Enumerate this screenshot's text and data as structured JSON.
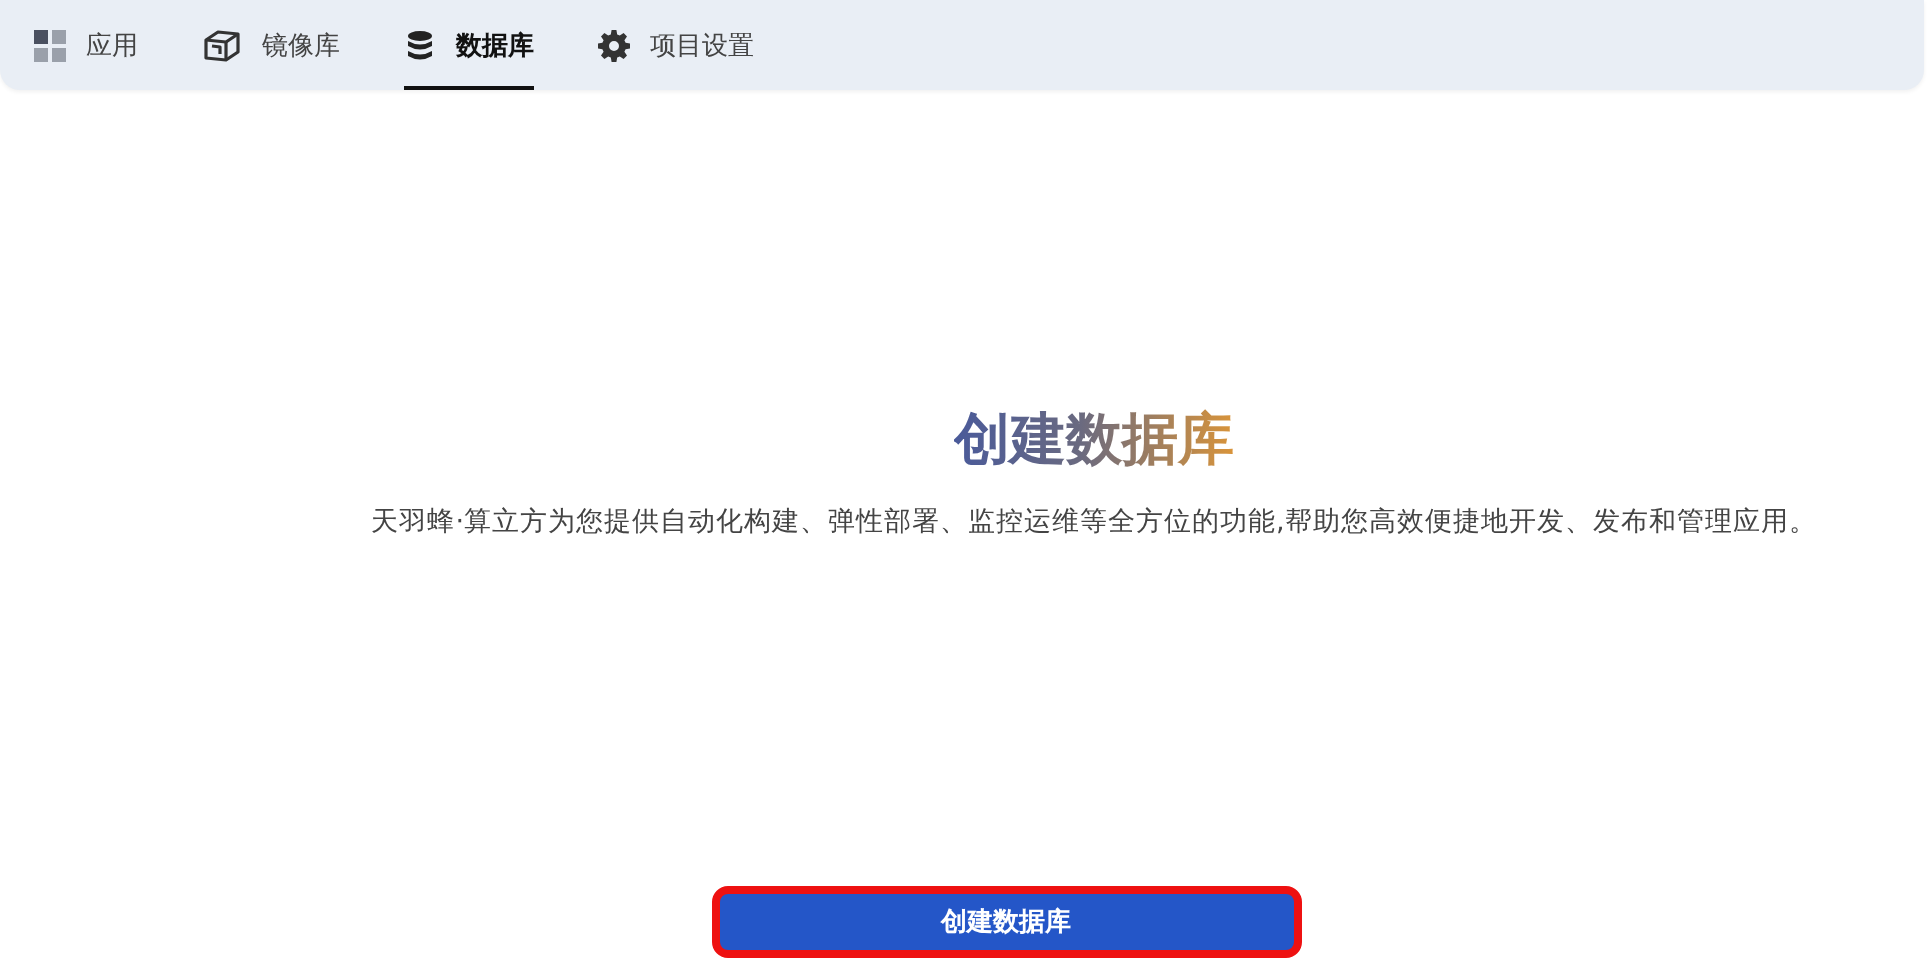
{
  "tabs": [
    {
      "label": "应用",
      "selected": false
    },
    {
      "label": "镜像库",
      "selected": false
    },
    {
      "label": "数据库",
      "selected": true
    },
    {
      "label": "项目设置",
      "selected": false
    }
  ],
  "empty_state": {
    "title": "创建数据库",
    "description": "天羽蜂·算立方为您提供自动化构建、弹性部署、监控运维等全方位的功能,帮助您高效便捷地开发、发布和管理应用。",
    "button": "创建数据库"
  }
}
